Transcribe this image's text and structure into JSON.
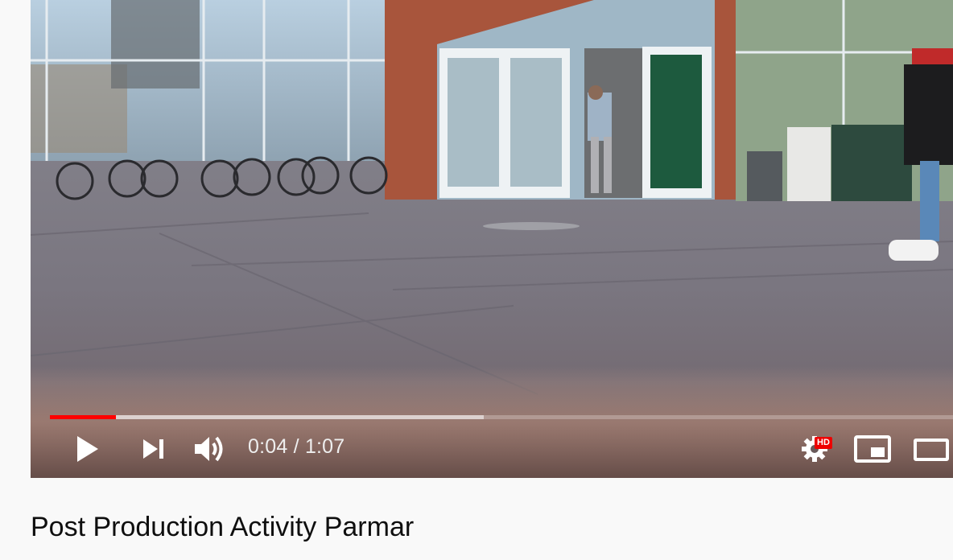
{
  "video": {
    "title": "Post Production Activity Parmar",
    "current_time": "0:04",
    "separator": "/",
    "duration": "1:07",
    "progress_played": 0.073,
    "progress_loaded": 0.48,
    "quality_badge": "HD",
    "colors": {
      "played": "#ff0000",
      "title": "#0f0f0f"
    }
  },
  "controls": {
    "play": "play-icon",
    "next": "skip-next-icon",
    "volume": "volume-icon",
    "settings": "gear-icon",
    "miniplayer": "miniplayer-icon",
    "theater": "theater-mode-icon"
  }
}
